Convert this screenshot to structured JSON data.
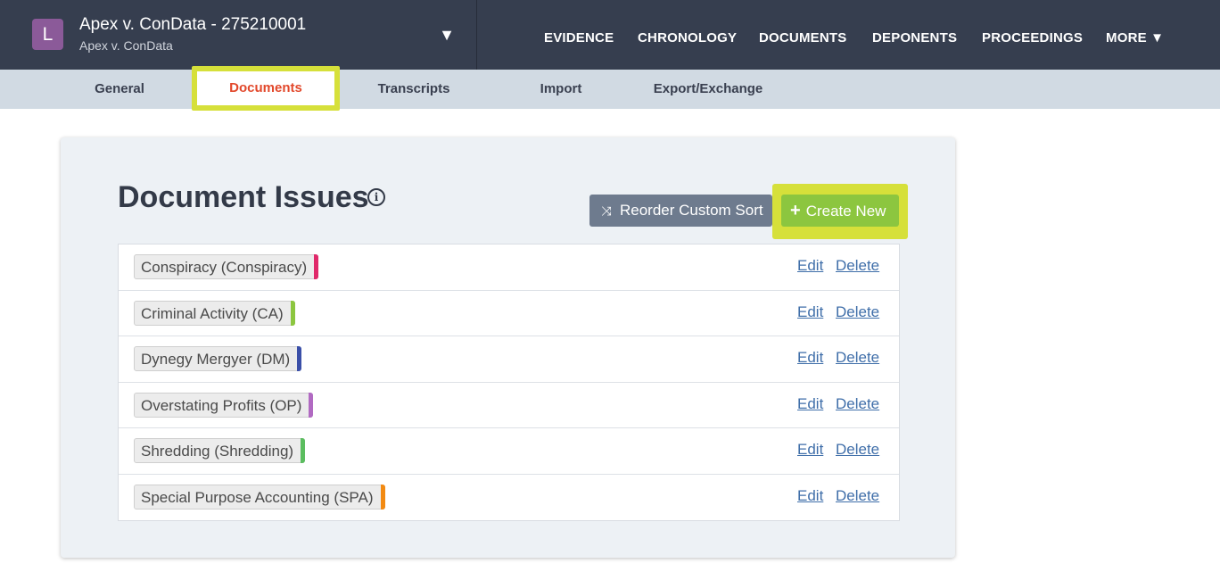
{
  "header": {
    "avatar_letter": "L",
    "case_title": "Apex v. ConData - 275210001",
    "case_subtitle": "Apex v. ConData",
    "toggle_glyph": "▼",
    "nav": [
      "EVIDENCE",
      "CHRONOLOGY",
      "DOCUMENTS",
      "DEPONENTS",
      "PROCEEDINGS",
      "MORE ▼"
    ]
  },
  "subnav": {
    "tabs": [
      "General",
      "Documents",
      "Transcripts",
      "Import",
      "Export/Exchange"
    ],
    "active": "Documents"
  },
  "main": {
    "title": "Document Issues",
    "info_glyph": "i",
    "reorder_icon": "shuffle-icon",
    "reorder_label": "Reorder Custom Sort",
    "create_icon": "plus-icon",
    "create_label": "Create New",
    "edit_label": "Edit",
    "delete_label": "Delete",
    "issues": [
      {
        "label": "Conspiracy (Conspiracy)",
        "color": "#e0296a"
      },
      {
        "label": "Criminal Activity (CA)",
        "color": "#8cc63f"
      },
      {
        "label": "Dynegy Mergyer (DM)",
        "color": "#3a4fa8"
      },
      {
        "label": "Overstating Profits (OP)",
        "color": "#b16ac2"
      },
      {
        "label": "Shredding (Shredding)",
        "color": "#5bbd5f"
      },
      {
        "label": "Special Purpose Accounting (SPA)",
        "color": "#f28a12"
      }
    ]
  }
}
